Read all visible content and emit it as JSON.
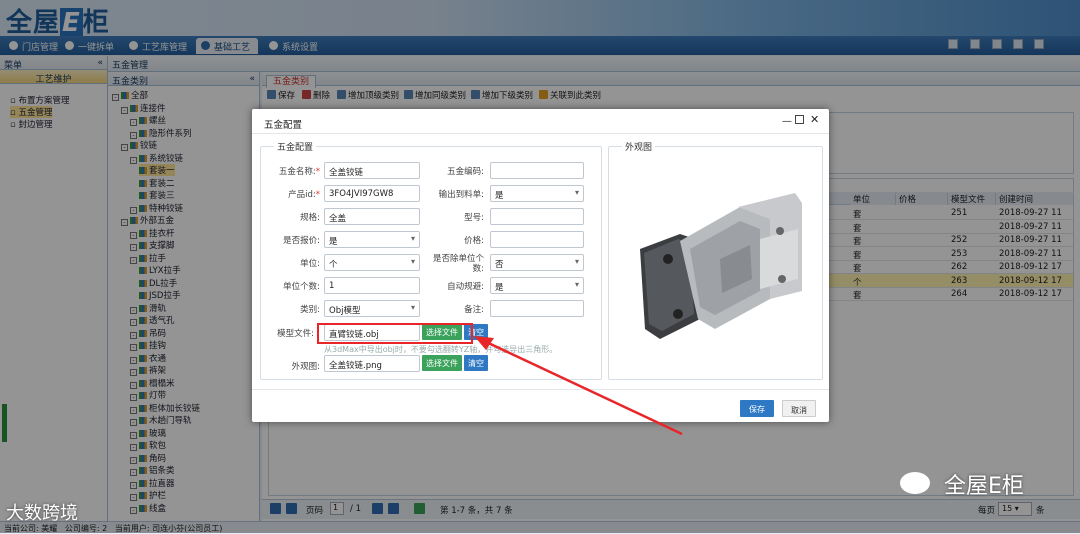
{
  "header": {
    "logo_prefix": "全屋",
    "logo_e": "E",
    "logo_suffix": "柜"
  },
  "nav": {
    "tabs": [
      {
        "label": "门店管理"
      },
      {
        "label": "一键拆单"
      },
      {
        "label": "工艺库管理"
      },
      {
        "label": "基础工艺",
        "active": true
      },
      {
        "label": "系统设置"
      }
    ]
  },
  "menu": {
    "title": "菜单",
    "section": "工艺维护",
    "items": [
      "布置方案管理",
      "五金管理",
      "封边管理"
    ]
  },
  "breadcrumb": "五金管理",
  "category_panel": {
    "title": "五金类别",
    "tree": [
      {
        "label": "全部",
        "level": 0
      },
      {
        "label": "连接件",
        "level": 1
      },
      {
        "label": "螺丝",
        "level": 2
      },
      {
        "label": "隐形件系列",
        "level": 2
      },
      {
        "label": "铰链",
        "level": 1
      },
      {
        "label": "系统铰链",
        "level": 2
      },
      {
        "label": "套装一",
        "level": 3,
        "selected": true
      },
      {
        "label": "套装二",
        "level": 3
      },
      {
        "label": "套装三",
        "level": 3
      },
      {
        "label": "特种铰链",
        "level": 2
      },
      {
        "label": "外部五金",
        "level": 1
      },
      {
        "label": "挂衣杆",
        "level": 2
      },
      {
        "label": "支撑脚",
        "level": 2
      },
      {
        "label": "拉手",
        "level": 2
      },
      {
        "label": "LYX拉手",
        "level": 3
      },
      {
        "label": "DL拉手",
        "level": 3
      },
      {
        "label": "JSD拉手",
        "level": 3
      },
      {
        "label": "滑轨",
        "level": 2
      },
      {
        "label": "透气孔",
        "level": 2
      },
      {
        "label": "吊码",
        "level": 2
      },
      {
        "label": "挂钩",
        "level": 2
      },
      {
        "label": "衣通",
        "level": 2
      },
      {
        "label": "裤架",
        "level": 2
      },
      {
        "label": "榻榻米",
        "level": 2
      },
      {
        "label": "灯带",
        "level": 2
      },
      {
        "label": "柜体加长铰链",
        "level": 2
      },
      {
        "label": "木趟门导轨",
        "level": 2
      },
      {
        "label": "玻璃",
        "level": 2
      },
      {
        "label": "软包",
        "level": 2
      },
      {
        "label": "角码",
        "level": 2
      },
      {
        "label": "铝条类",
        "level": 2
      },
      {
        "label": "拉直器",
        "level": 2
      },
      {
        "label": "护栏",
        "level": 2
      },
      {
        "label": "线盒",
        "level": 2
      }
    ]
  },
  "main": {
    "tab": "五金类别",
    "toolbar": [
      "保存",
      "删除",
      "增加顶级类别",
      "增加同级类别",
      "增加下级类别",
      "关联到此类别"
    ],
    "grid": {
      "columns": [
        "单位",
        "价格",
        "模型文件",
        "创建时间"
      ],
      "rows": [
        {
          "unit": "套",
          "price": "",
          "model": "251",
          "created": "2018-09-27 11"
        },
        {
          "unit": "套",
          "price": "",
          "model": "",
          "created": "2018-09-27 11"
        },
        {
          "unit": "套",
          "price": "",
          "model": "252",
          "created": "2018-09-27 11"
        },
        {
          "unit": "套",
          "price": "",
          "model": "253",
          "created": "2018-09-27 11"
        },
        {
          "unit": "套",
          "price": "",
          "model": "262",
          "created": "2018-09-12 17"
        },
        {
          "unit": "个",
          "price": "",
          "model": "263",
          "created": "2018-09-12 17",
          "highlight": true
        },
        {
          "unit": "套",
          "price": "",
          "model": "264",
          "created": "2018-09-12 17"
        }
      ]
    },
    "pager": {
      "page_label": "页码",
      "page": "1",
      "total_pages": "/ 1",
      "summary": "第 1-7 条，共 7 条",
      "per_page_label": "每页",
      "per_page": "15",
      "unit": "条"
    }
  },
  "dialog": {
    "title": "五金配置",
    "section_left": "五金配置",
    "section_right": "外观图",
    "fields": {
      "name_label": "五金名称:",
      "name_value": "全盖铰链",
      "code_label": "五金编码:",
      "code_value": "",
      "pid_label": "产品id:",
      "pid_value": "3FO4JVI97GW8",
      "export_label": "输出到料单:",
      "export_value": "是",
      "spec_label": "规格:",
      "spec_value": "全盖",
      "model_no_label": "型号:",
      "model_no_value": "",
      "quote_label": "是否报价:",
      "quote_value": "是",
      "price_label": "价格:",
      "price_value": "",
      "unit_label": "单位:",
      "unit_value": "个",
      "divide_label": "是否除单位个数:",
      "divide_value": "否",
      "count_label": "单位个数:",
      "count_value": "1",
      "auto_label": "自动规避:",
      "auto_value": "是",
      "type_label": "类别:",
      "type_value": "Obj模型",
      "note_label": "备注:",
      "note_value": "",
      "modelfile_label": "模型文件:",
      "modelfile_value": "直臂铰链.obj",
      "hint": "从3dMax中导出obj时，不要勾选翻转YZ轴，并勾选导出三角形。",
      "appearance_label": "外观图:",
      "appearance_value": "全盖铰链.png"
    },
    "choose_file": "选择文件",
    "clear": "清空",
    "save": "保存",
    "cancel": "取消"
  },
  "status": {
    "company_label": "当前公司:",
    "company": "美耀",
    "code_label": "公司编号:",
    "code": "2",
    "user_label": "当前用户:",
    "user": "司连小芬(公司员工)"
  },
  "watermarks": {
    "left": "大数跨境",
    "right": "全屋E柜"
  },
  "colors": {
    "accent": "#2f78c4",
    "save_button": "#2f78c4",
    "choose_button": "#3aa25a",
    "annotation": "#e8262a",
    "selected_row": "#ffe79a"
  }
}
